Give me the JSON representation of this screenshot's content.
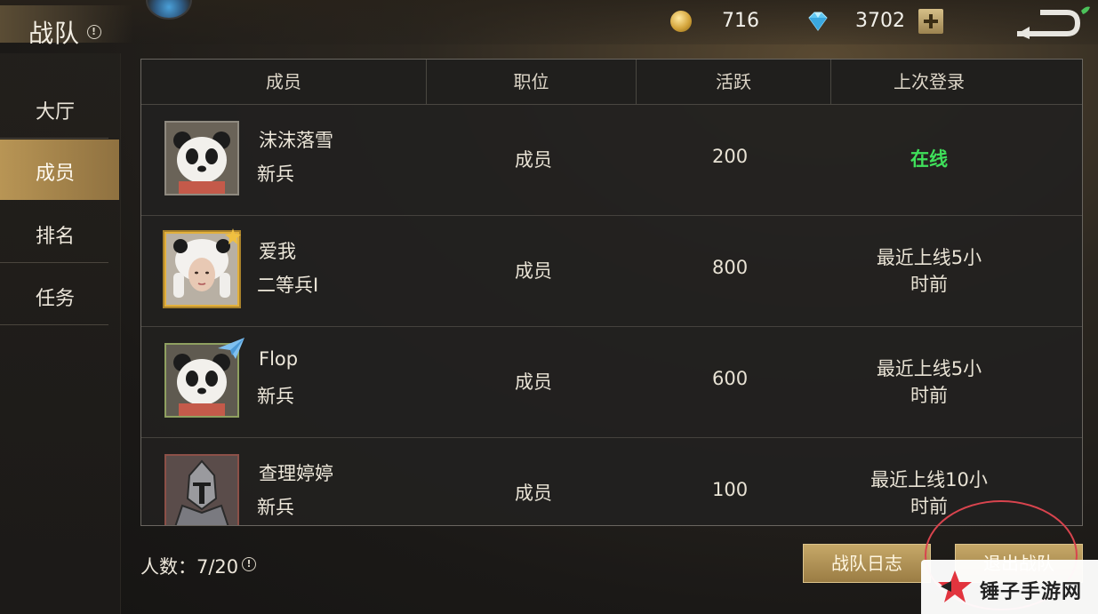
{
  "header": {
    "title": "战队"
  },
  "currency": {
    "gold": "716",
    "diamond": "3702"
  },
  "sidebar": {
    "items": [
      {
        "label": "大厅"
      },
      {
        "label": "成员"
      },
      {
        "label": "排名"
      },
      {
        "label": "任务"
      }
    ]
  },
  "table": {
    "headers": [
      "成员",
      "职位",
      "活跃",
      "上次登录"
    ],
    "rows": [
      {
        "name": "沫沫落雪",
        "rank": "新兵",
        "role": "成员",
        "activity": "200",
        "last_login_line1": "在线",
        "last_login_line2": ""
      },
      {
        "name": "爱我",
        "rank": "二等兵I",
        "role": "成员",
        "activity": "800",
        "last_login_line1": "最近上线5小",
        "last_login_line2": "时前"
      },
      {
        "name": "Flop",
        "rank": "新兵",
        "role": "成员",
        "activity": "600",
        "last_login_line1": "最近上线5小",
        "last_login_line2": "时前"
      },
      {
        "name": "查理婷婷",
        "rank": "新兵",
        "role": "成员",
        "activity": "100",
        "last_login_line1": "最近上线10小",
        "last_login_line2": "时前"
      }
    ]
  },
  "footer": {
    "member_count": "人数：7/20",
    "log_button": "战队日志",
    "leave_button": "退出战队"
  },
  "watermark": {
    "text": "锤子手游网"
  },
  "colors": {
    "online": "#3fe05a",
    "accent": "#b89555",
    "highlight": "#d9444e"
  }
}
